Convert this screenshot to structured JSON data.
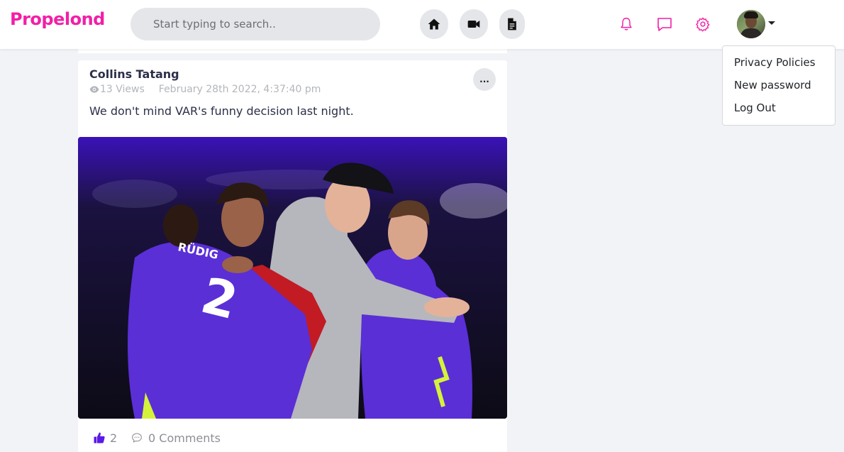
{
  "header": {
    "brand": "Propelond",
    "search_placeholder": "Start typing to search..",
    "accent_color": "#f21fa6"
  },
  "nav_icons": [
    "home-icon",
    "video-camera-icon",
    "document-icon"
  ],
  "action_icons": [
    "bell-icon",
    "chat-icon",
    "gear-icon"
  ],
  "user_menu": {
    "items": [
      "Privacy Policies",
      "New password",
      "Log Out"
    ]
  },
  "post": {
    "author": "Collins Tatang",
    "views": "13 Views",
    "date": "February 28th 2022, 4:37:40 pm",
    "more_label": "...",
    "text": "We don't mind VAR's funny decision last night.",
    "likes": "2",
    "comments": "0 Comments",
    "like_color": "#5b19e8"
  }
}
